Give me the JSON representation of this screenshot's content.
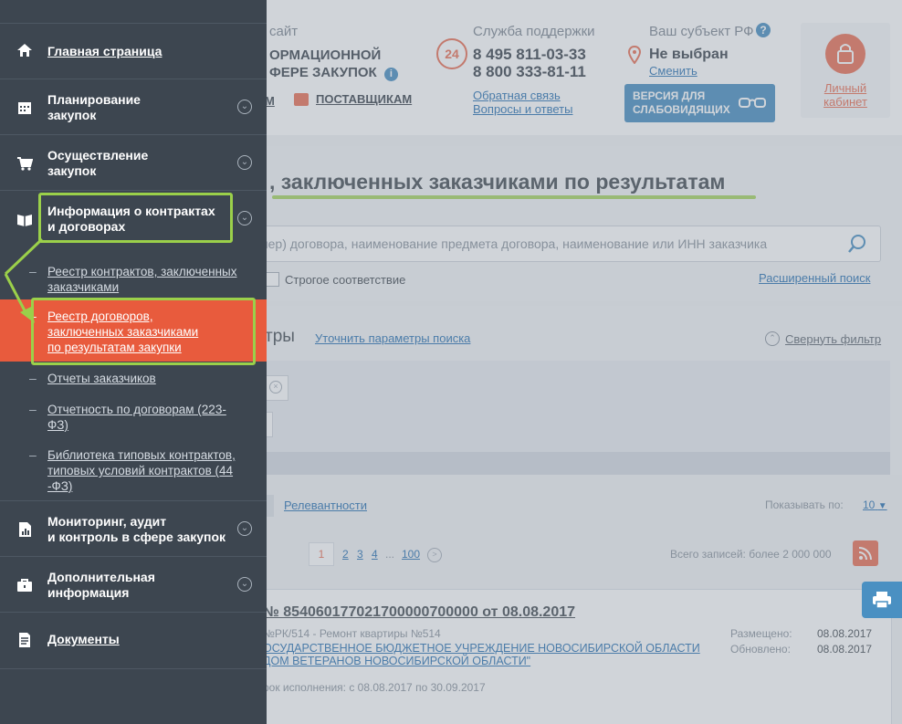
{
  "header": {
    "site_partial_l1": "сайт",
    "site_partial_l2": "ОРМАЦИОННОЙ",
    "site_partial_l3": "ФЕРЕ ЗАКУПОК",
    "m_partial": "М",
    "suppliers": "ПОСТАВЩИКАМ",
    "support_title": "Служба поддержки",
    "phone1": "8 495 811-03-33",
    "phone2": "8 800 333-81-11",
    "feedback_link": "Обратная связь",
    "faq_link": "Вопросы и ответы",
    "badge_24": "24",
    "region_title": "Ваш субъект РФ",
    "region_value": "Не выбран",
    "region_change": "Сменить",
    "vision_btn_l1": "ВЕРСИЯ ДЛЯ",
    "vision_btn_l2": "СЛАБОВИДЯЩИХ",
    "cabinet_l1": "Личный",
    "cabinet_l2": "кабинет"
  },
  "main": {
    "title_partial": ", заключенных заказчиками по результатам",
    "search_placeholder": "мер) договора, наименование предмета договора, наименование или ИНН заказчика",
    "strict_match": "Строгое соответствие",
    "advanced_search": "Расширенный поиск",
    "filters_partial": "тры",
    "refine_params": "Уточнить параметры поиска",
    "collapse_filter": "Свернуть фильтр",
    "sort_relevance": "Релевантности",
    "show_by_label": "Показывать по:",
    "show_by_value": "10",
    "pages": [
      "1",
      "2",
      "3",
      "4",
      "...",
      "100"
    ],
    "total_records": "Всего записей: более 2 000 000",
    "card": {
      "number": "№ 854060177021700000700000 от 08.08.2017",
      "subtitle": "№РК/514 - Ремонт квартиры №514",
      "org_l1": "ОСУДАРСТВЕННОЕ БЮДЖЕТНОЕ УЧРЕЖДЕНИЕ НОВОСИБИРСКОЙ ОБЛАСТИ",
      "org_l2": "ДОМ ВЕТЕРАНОВ НОВОСИБИРСКОЙ ОБЛАСТИ\"",
      "placed_label": "Размещено:",
      "placed_value": "08.08.2017",
      "updated_label": "Обновлено:",
      "updated_value": "08.08.2017",
      "execution": "рок исполнения: с 08.08.2017 по 30.09.2017"
    }
  },
  "sidebar": {
    "items": [
      {
        "label": "Главная страница",
        "icon": "home-icon"
      },
      {
        "label_l1": "Планирование",
        "label_l2": "закупок",
        "icon": "calendar-icon"
      },
      {
        "label_l1": "Осуществление",
        "label_l2": "закупок",
        "icon": "cart-icon"
      },
      {
        "label_l1": "Информация о контрактах",
        "label_l2": "и договорах",
        "icon": "book-icon"
      },
      {
        "label_l1": "Мониторинг, аудит",
        "label_l2": "и контроль в сфере закупок",
        "icon": "chart-doc-icon"
      },
      {
        "label_l1": "Дополнительная",
        "label_l2": "информация",
        "icon": "briefcase-icon"
      },
      {
        "label": "Документы",
        "icon": "document-icon"
      }
    ],
    "subitems": [
      {
        "l1": "Реестр контрактов, заключенных",
        "l2": "заказчиками"
      },
      {
        "l1": "Реестр договоров,",
        "l2": "заключенных заказчиками",
        "l3": "по результатам закупки"
      },
      {
        "l1": "Отчеты заказчиков"
      },
      {
        "l1": "Отчетность по договорам (223-",
        "l2": "ФЗ)"
      },
      {
        "l1": "Библиотека типовых контрактов,",
        "l2": "типовых условий контрактов (44",
        "l3": "-ФЗ)"
      }
    ]
  },
  "colors": {
    "sidebar_bg": "#3d4650",
    "active_item": "#e85b3d",
    "highlight_green": "#9bd04a",
    "accent_blue": "#0d5fa8",
    "vision_btn": "#2f7fb8"
  }
}
